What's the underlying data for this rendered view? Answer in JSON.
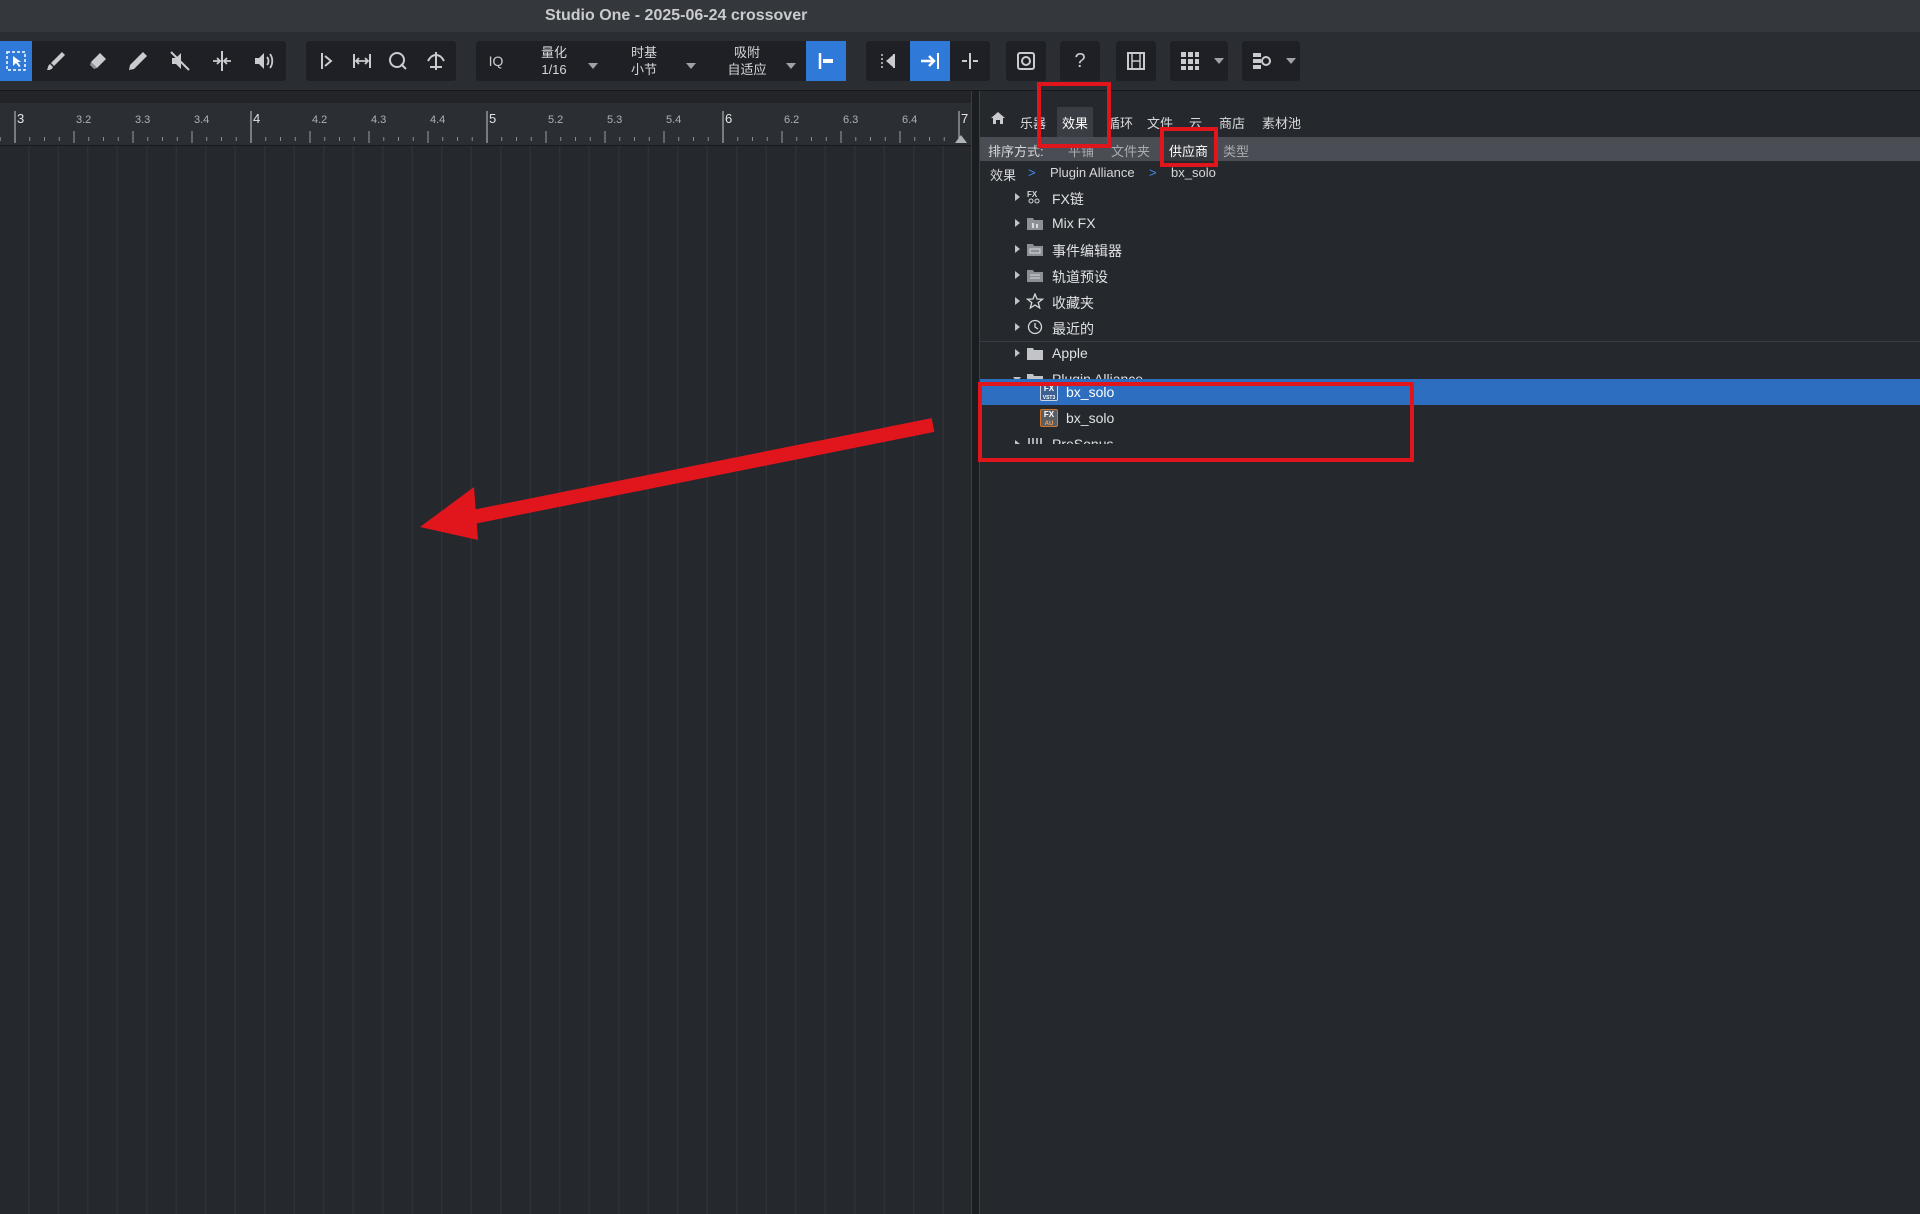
{
  "window": {
    "title": "Studio One - 2025-06-24 crossover"
  },
  "toolbar": {
    "tools": [
      {
        "name": "select-arrow-icon"
      },
      {
        "name": "paint-brush-icon"
      },
      {
        "name": "eraser-icon"
      },
      {
        "name": "pencil-icon"
      },
      {
        "name": "mute-tool-icon"
      },
      {
        "name": "split-tool-icon"
      },
      {
        "name": "listen-speaker-icon"
      }
    ],
    "iq_label": "IQ",
    "quantize": {
      "label": "量化",
      "value": "1/16"
    },
    "timebase": {
      "label": "时基",
      "value": "小节"
    },
    "snap": {
      "label": "吸附",
      "value": "自适应"
    },
    "help_label": "?"
  },
  "ruler": {
    "marks": [
      {
        "label": "3",
        "major": true
      },
      {
        "label": "3.2",
        "major": false
      },
      {
        "label": "3.3",
        "major": false
      },
      {
        "label": "3.4",
        "major": false
      },
      {
        "label": "4",
        "major": true
      },
      {
        "label": "4.2",
        "major": false
      },
      {
        "label": "4.3",
        "major": false
      },
      {
        "label": "4.4",
        "major": false
      },
      {
        "label": "5",
        "major": true
      },
      {
        "label": "5.2",
        "major": false
      },
      {
        "label": "5.3",
        "major": false
      },
      {
        "label": "5.4",
        "major": false
      },
      {
        "label": "6",
        "major": true
      },
      {
        "label": "6.2",
        "major": false
      },
      {
        "label": "6.3",
        "major": false
      },
      {
        "label": "6.4",
        "major": false
      },
      {
        "label": "7",
        "major": true
      }
    ]
  },
  "browser": {
    "tabs": [
      "乐器",
      "效果",
      "循环",
      "文件",
      "云",
      "商店",
      "素材池"
    ],
    "active_tab": "效果",
    "sort": {
      "label": "排序方式:",
      "options": [
        "平铺",
        "文件夹",
        "供应商",
        "类型"
      ],
      "selected": "供应商"
    },
    "breadcrumb": [
      "效果",
      "Plugin Alliance",
      "bx_solo"
    ],
    "breadcrumb_sep": ">",
    "tree": {
      "categories": [
        {
          "label": "FX链",
          "icon": "fx-chain-icon"
        },
        {
          "label": "Mix FX",
          "icon": "mix-fx-icon"
        },
        {
          "label": "事件编辑器",
          "icon": "event-editor-icon"
        },
        {
          "label": "轨道预设",
          "icon": "track-preset-icon"
        },
        {
          "label": "收藏夹",
          "icon": "star-icon"
        },
        {
          "label": "最近的",
          "icon": "clock-icon"
        }
      ],
      "vendors": [
        {
          "label": "Apple",
          "icon": "folder-icon"
        },
        {
          "label": "Plugin Alliance",
          "icon": "folder-open-icon"
        }
      ],
      "plugins": [
        {
          "label": "bx_solo",
          "format": "VST3",
          "badge_color": "#4a78b8",
          "selected": true
        },
        {
          "label": "bx_solo",
          "format": "AU",
          "badge_color": "#d2762a",
          "selected": false
        }
      ],
      "next_vendor": {
        "label": "PreSonus",
        "icon": "presonus-icon"
      }
    }
  },
  "annotations": {
    "highlight_color": "#e0161c"
  }
}
